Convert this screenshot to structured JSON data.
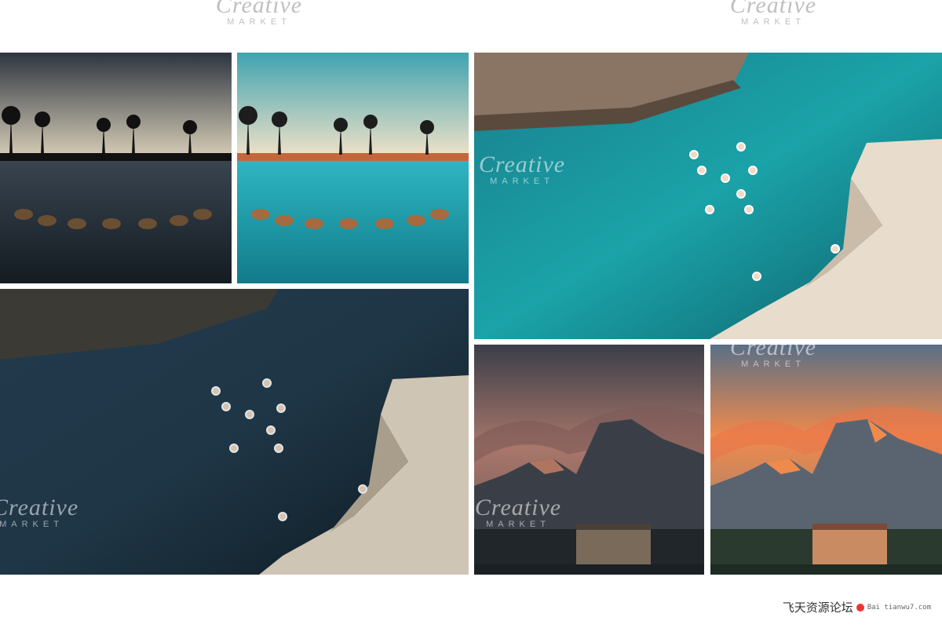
{
  "watermarks": {
    "brand": "Creative",
    "sub": "MARKET"
  },
  "site_mark": {
    "name": "飞天资源论坛",
    "url": "Bai tianwu7.com"
  },
  "icons": {
    "site_logo": "red-dot-icon"
  },
  "colors": {
    "background": "#ffffff",
    "teal_water": "#1aa3a8",
    "dark_water": "#1f3646",
    "sunset_orange": "#f08a4b"
  }
}
